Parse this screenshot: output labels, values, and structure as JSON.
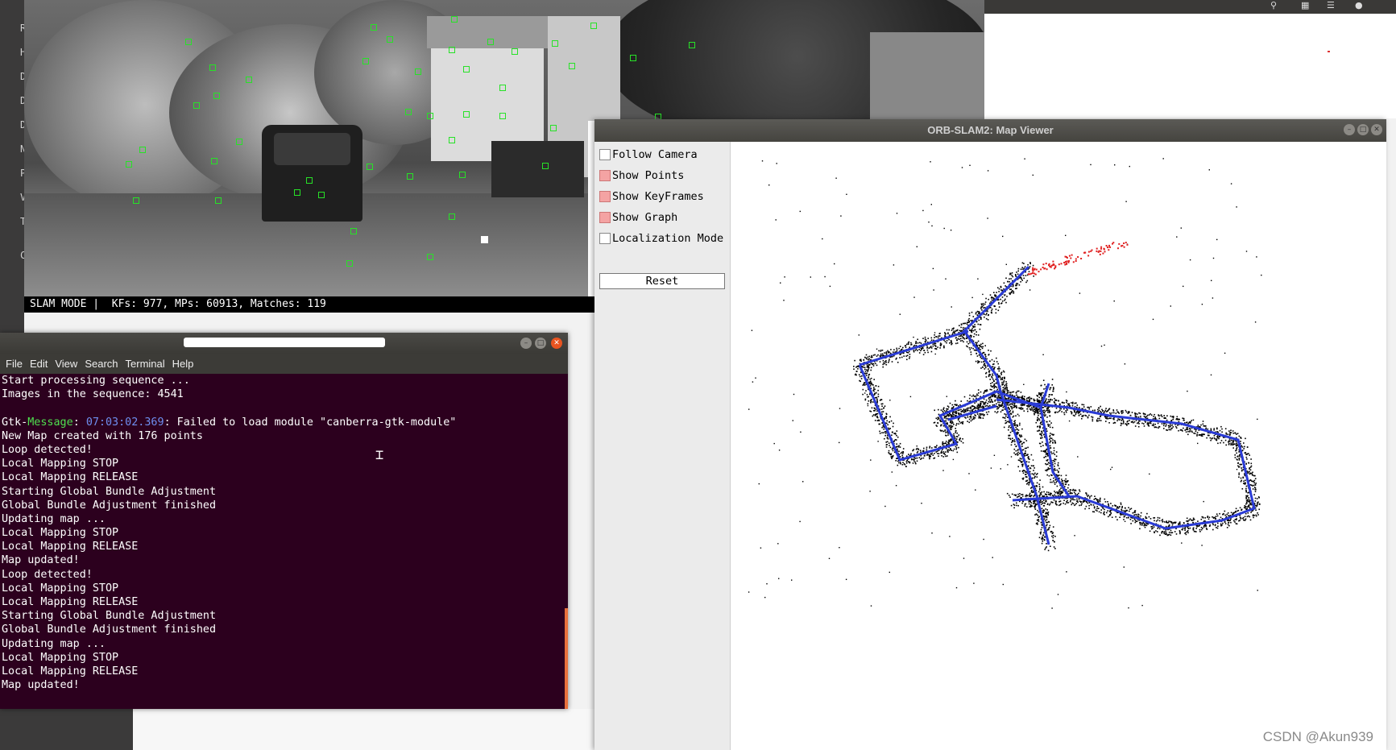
{
  "camera": {
    "status_text": "SLAM MODE |  KFs: 977, MPs: 60913, Matches: 119"
  },
  "left_dock": {
    "glyphs": [
      "R",
      "H",
      "D",
      "D",
      "D",
      "N",
      "P",
      "V",
      "T",
      "C"
    ]
  },
  "terminal": {
    "menu": [
      "File",
      "Edit",
      "View",
      "Search",
      "Terminal",
      "Help"
    ],
    "lines": [
      "Start processing sequence ...",
      "Images in the sequence: 4541",
      "",
      "__GTK__",
      "New Map created with 176 points",
      "Loop detected!",
      "Local Mapping STOP",
      "Local Mapping RELEASE",
      "Starting Global Bundle Adjustment",
      "Global Bundle Adjustment finished",
      "Updating map ...",
      "Local Mapping STOP",
      "Local Mapping RELEASE",
      "Map updated!",
      "Loop detected!",
      "Local Mapping STOP",
      "Local Mapping RELEASE",
      "Starting Global Bundle Adjustment",
      "Global Bundle Adjustment finished",
      "Updating map ...",
      "Local Mapping STOP",
      "Local Mapping RELEASE",
      "Map updated!"
    ],
    "gtk_prefix": "Gtk-",
    "gtk_message_word": "Message",
    "gtk_colon": ": ",
    "gtk_timestamp": "07:03:02.369",
    "gtk_rest": ": Failed to load module \"canberra-gtk-module\""
  },
  "map_viewer": {
    "title": "ORB-SLAM2: Map Viewer",
    "options": [
      {
        "label": "Follow Camera",
        "checked": false
      },
      {
        "label": "Show Points",
        "checked": true
      },
      {
        "label": "Show KeyFrames",
        "checked": true
      },
      {
        "label": "Show Graph",
        "checked": true
      },
      {
        "label": "Localization Mode",
        "checked": false
      }
    ],
    "reset_label": "Reset",
    "colors": {
      "trajectory": "#2a3bd6",
      "points": "#000000",
      "current_points": "#e02020"
    }
  },
  "watermark": "CSDN @Akun939"
}
